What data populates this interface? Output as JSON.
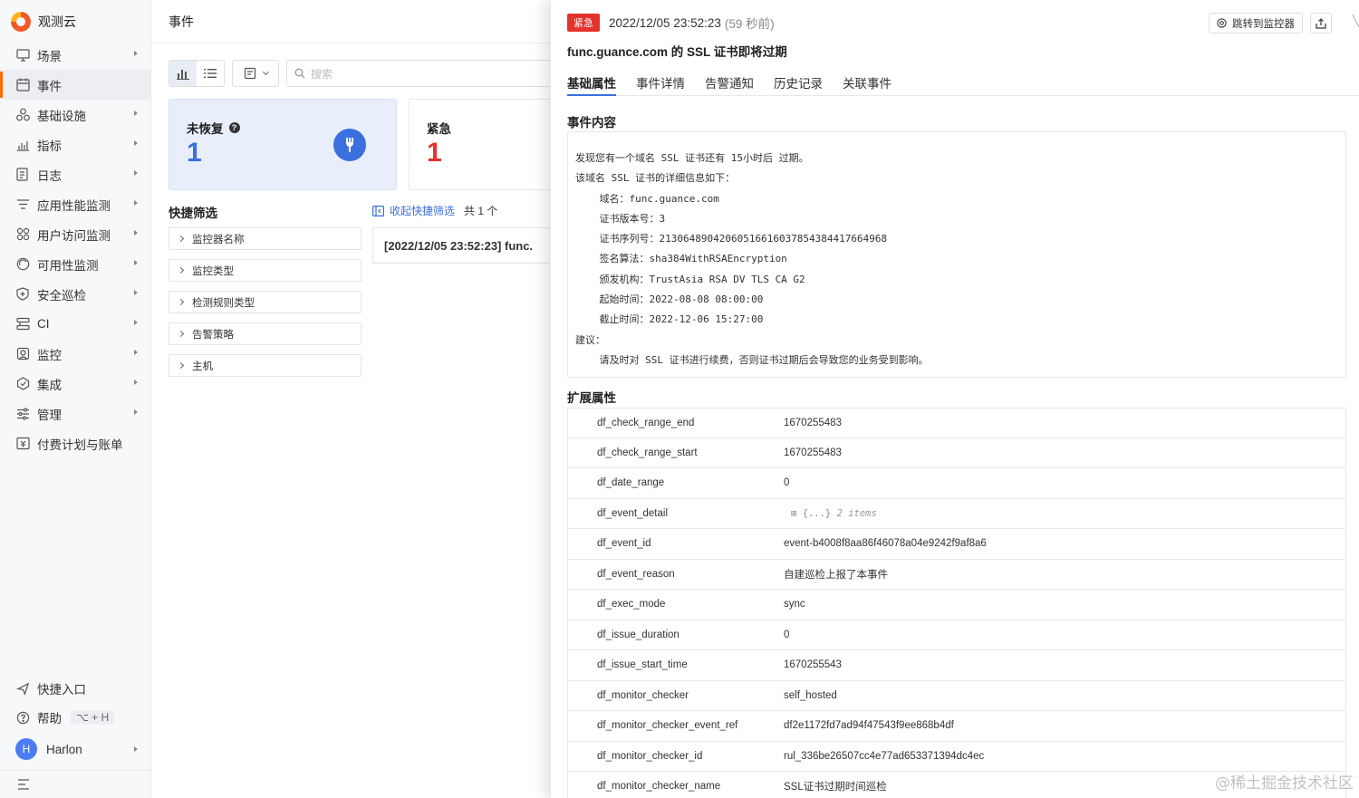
{
  "app": {
    "name": "观测云"
  },
  "sidebar": {
    "items": [
      {
        "label": "场景",
        "icon": "monitor-icon",
        "arrow": true
      },
      {
        "label": "事件",
        "icon": "calendar-icon",
        "arrow": false,
        "active": true
      },
      {
        "label": "基础设施",
        "icon": "cluster-icon",
        "arrow": true
      },
      {
        "label": "指标",
        "icon": "chart-icon",
        "arrow": true
      },
      {
        "label": "日志",
        "icon": "log-icon",
        "arrow": true
      },
      {
        "label": "应用性能监测",
        "icon": "apm-icon",
        "arrow": true
      },
      {
        "label": "用户访问监测",
        "icon": "rum-icon",
        "arrow": true
      },
      {
        "label": "可用性监测",
        "icon": "dial-icon",
        "arrow": true
      },
      {
        "label": "安全巡检",
        "icon": "shield-icon",
        "arrow": true
      },
      {
        "label": "CI",
        "icon": "ci-icon",
        "arrow": true
      },
      {
        "label": "监控",
        "icon": "monitor-watch-icon",
        "arrow": true
      },
      {
        "label": "集成",
        "icon": "integration-icon",
        "arrow": true
      },
      {
        "label": "管理",
        "icon": "sliders-icon",
        "arrow": true
      },
      {
        "label": "付费计划与账单",
        "icon": "billing-icon",
        "arrow": false
      }
    ],
    "quick_entry": "快捷入口",
    "help": "帮助",
    "help_shortcut": "⌥ + H",
    "user": {
      "initial": "H",
      "name": "Harlon"
    }
  },
  "middle": {
    "header": "事件",
    "search_placeholder": "搜索",
    "cards": [
      {
        "title": "未恢复",
        "count": "1"
      },
      {
        "title": "紧急",
        "count": "1"
      }
    ],
    "quick_filter": {
      "title": "快捷筛选",
      "collapse_label": "收起快捷筛选",
      "count_label": "共 1 个",
      "items": [
        "监控器名称",
        "监控类型",
        "检测规则类型",
        "告警策略",
        "主机"
      ]
    },
    "event_row": "[2022/12/05 23:52:23] func."
  },
  "drawer": {
    "badge": "紧急",
    "timestamp": "2022/12/05 23:52:23",
    "ago": "(59 秒前)",
    "jump_label": "跳转到监控器",
    "title": "func.guance.com 的 SSL 证书即将过期",
    "tabs": [
      "基础属性",
      "事件详情",
      "告警通知",
      "历史记录",
      "关联事件"
    ],
    "content_title": "事件内容",
    "content_lines": [
      "发现您有一个域名 SSL 证书还有 15小时后 过期。",
      "该域名 SSL 证书的详细信息如下：",
      "    域名：func.guance.com",
      "    证书版本号：3",
      "    证书序列号：21306489042060516616037854384417664968",
      "    签名算法：sha384WithRSAEncryption",
      "    颁发机构：TrustAsia RSA DV TLS CA G2",
      "    起始时间：2022-08-08 08:00:00",
      "    截止时间：2022-12-06 15:27:00",
      "建议：",
      "    请及时对 SSL 证书进行续费，否则证书过期后会导致您的业务受到影响。"
    ],
    "ext_title": "扩展属性",
    "ext_rows": [
      {
        "key": "df_check_range_end",
        "value": "1670255483"
      },
      {
        "key": "df_check_range_start",
        "value": "1670255483"
      },
      {
        "key": "df_date_range",
        "value": "0"
      },
      {
        "key": "df_event_detail",
        "value": "⊞ {...} ",
        "extra": "2 items"
      },
      {
        "key": "df_event_id",
        "value": "event-b4008f8aa86f46078a04e9242f9af8a6"
      },
      {
        "key": "df_event_reason",
        "value": "自建巡检上报了本事件"
      },
      {
        "key": "df_exec_mode",
        "value": "sync"
      },
      {
        "key": "df_issue_duration",
        "value": "0"
      },
      {
        "key": "df_issue_start_time",
        "value": "1670255543"
      },
      {
        "key": "df_monitor_checker",
        "value": "self_hosted"
      },
      {
        "key": "df_monitor_checker_event_ref",
        "value": "df2e1172fd7ad94f47543f9ee868b4df"
      },
      {
        "key": "df_monitor_checker_id",
        "value": "rul_336be26507cc4e77ad653371394dc4ec"
      },
      {
        "key": "df_monitor_checker_name",
        "value": "SSL证书过期时间巡检"
      }
    ],
    "watermark": "@稀土掘金技术社区"
  }
}
